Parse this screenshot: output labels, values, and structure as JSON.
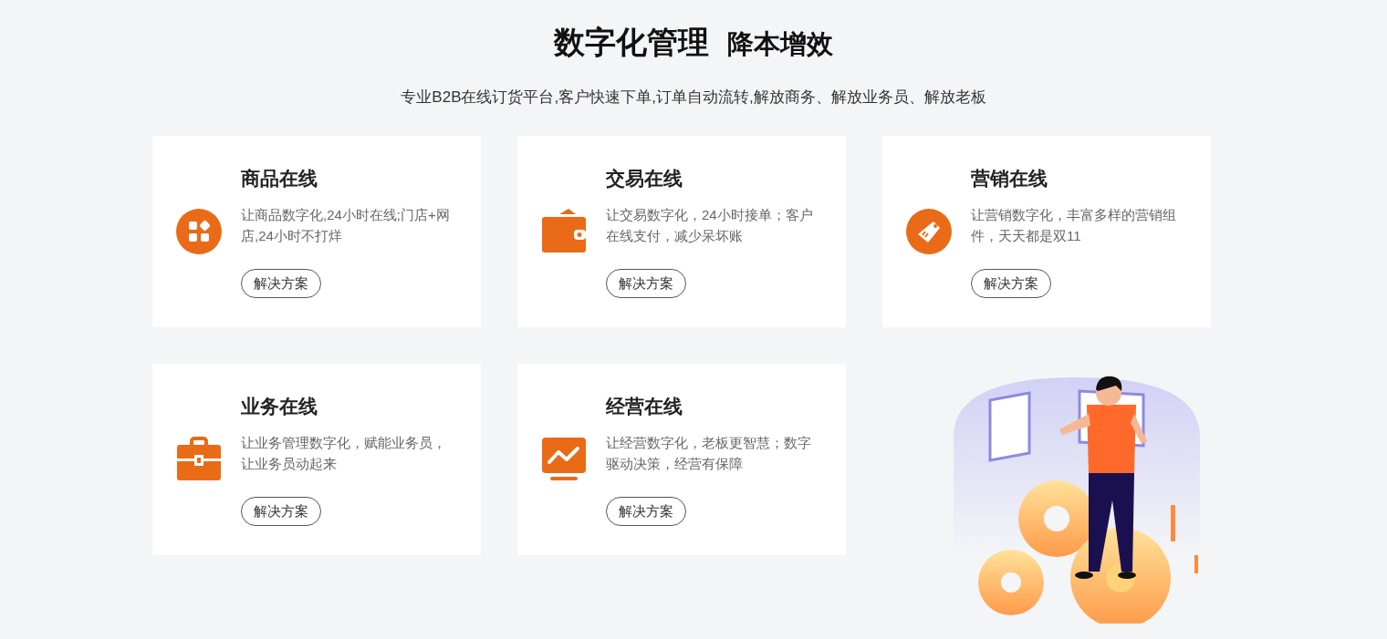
{
  "heading": {
    "title": "数字化管理",
    "tagline": "降本增效"
  },
  "subtitle": "专业B2B在线订货平台,客户快速下单,订单自动流转,解放商务、解放业务员、解放老板",
  "cards": [
    {
      "kind": "grid",
      "title": "商品在线",
      "description": "让商品数字化,24小时在线;门店+网店,24小时不打烊",
      "button": "解决方案"
    },
    {
      "kind": "wallet",
      "title": "交易在线",
      "description": "让交易数字化，24小时接单；客户在线支付，减少呆坏账",
      "button": "解决方案"
    },
    {
      "kind": "tag",
      "title": "营销在线",
      "description": "让营销数字化，丰富多样的营销组件，天天都是双11",
      "button": "解决方案"
    },
    {
      "kind": "briefcase",
      "title": "业务在线",
      "description": "让业务管理数字化，赋能业务员，让业务员动起来",
      "button": "解决方案"
    },
    {
      "kind": "monitor",
      "title": "经营在线",
      "description": "让经营数字化，老板更智慧；数字驱动决策，经营有保障",
      "button": "解决方案"
    }
  ]
}
